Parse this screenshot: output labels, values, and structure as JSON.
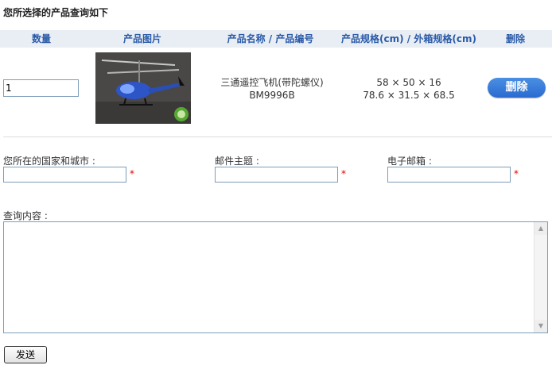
{
  "page_title": "您所选择的产品查询如下",
  "table": {
    "headers": {
      "quantity": "数量",
      "image": "产品图片",
      "name_code": "产品名称 / 产品编号",
      "spec": "产品规格(cm) / 外箱规格(cm)",
      "delete": "删除"
    },
    "rows": [
      {
        "quantity": "1",
        "name": "三通遥控飞机(带陀螺仪)",
        "code": "BM9996B",
        "product_size": "58 × 50 × 16",
        "carton_size": "78.6 × 31.5 × 68.5",
        "delete_label": "删除"
      }
    ]
  },
  "form": {
    "country_city_label": "您所在的国家和城市 :",
    "subject_label": "邮件主题 :",
    "email_label": "电子邮箱 :",
    "required_mark": "*",
    "content_label": "查询内容 :",
    "submit_label": "发送"
  }
}
